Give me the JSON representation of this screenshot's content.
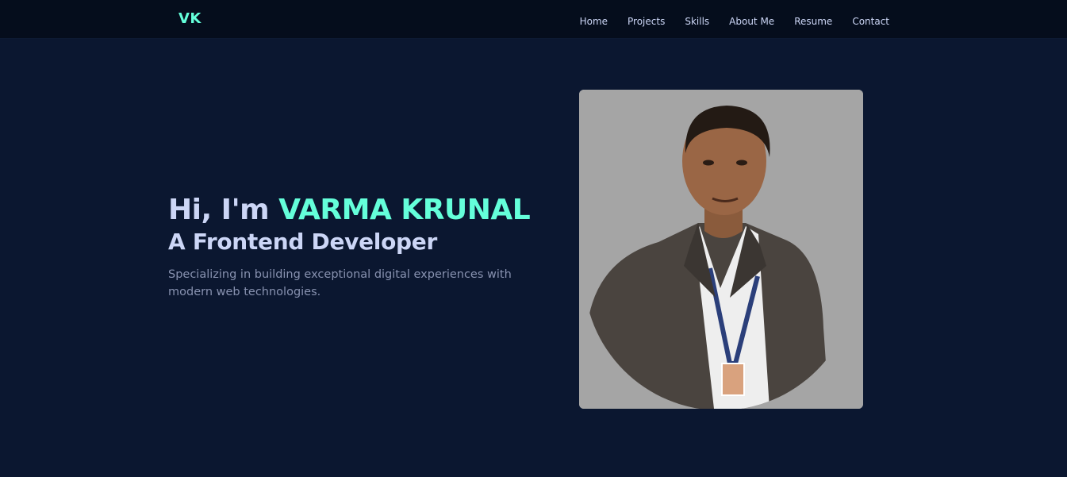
{
  "nav": {
    "logo": "VK",
    "links": [
      "Home",
      "Projects",
      "Skills",
      "About Me",
      "Resume",
      "Contact"
    ]
  },
  "hero": {
    "greeting": "Hi, I'm ",
    "name": "VARMA KRUNAL",
    "subtitle": "A Frontend Developer",
    "description": "Specializing in building exceptional digital experiences with modern web technologies."
  },
  "colors": {
    "background": "#0b1730",
    "navbar": "#050d1c",
    "accent": "#64ffda",
    "heading": "#ccd6f6",
    "body_text": "#8892b0",
    "photo_bg": "#a5a5a5"
  }
}
